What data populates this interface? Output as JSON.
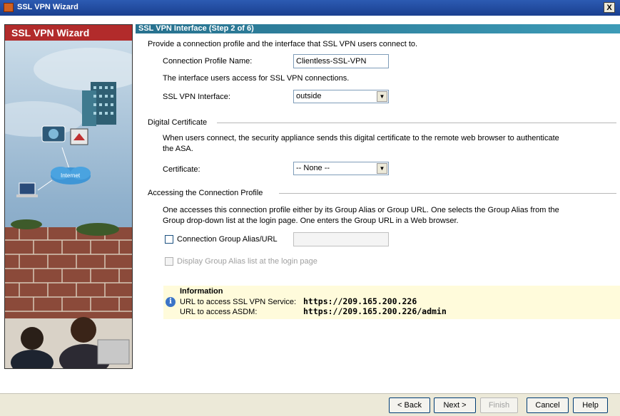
{
  "window": {
    "title": "SSL VPN Wizard",
    "close_label": "X"
  },
  "sidebar": {
    "title": "SSL VPN Wizard",
    "cloud_label": "Internet"
  },
  "header": {
    "step_title": "SSL VPN Interface  (Step 2 of 6)"
  },
  "intro": "Provide a connection profile and the interface that SSL VPN users connect to.",
  "connection_profile": {
    "label": "Connection Profile Name:",
    "value": "Clientless-SSL-VPN"
  },
  "interface_note": "The interface users access for SSL VPN connections.",
  "vpn_interface": {
    "label": "SSL VPN Interface:",
    "value": "outside",
    "arrow": "▼"
  },
  "digital_certificate": {
    "group_title": "Digital Certificate",
    "desc_line1": "When users connect, the security appliance sends this digital certificate to the remote web browser to authenticate",
    "desc_line2": "the ASA.",
    "label": "Certificate:",
    "value": "-- None --",
    "arrow": "▼"
  },
  "accessing": {
    "group_title": "Accessing the Connection Profile",
    "desc_line1": "One accesses this connection profile either by its Group Alias or Group URL. One selects the Group Alias from the",
    "desc_line2": "Group drop-down list at the login page. One enters the Group URL in a Web browser.",
    "alias_checkbox_label": "Connection Group Alias/URL",
    "alias_value": "",
    "display_list_label": "Display Group Alias list at the login page"
  },
  "information": {
    "title": "Information",
    "ssl_label": "URL to access SSL VPN Service:",
    "ssl_url": "https://209.165.200.226",
    "asdm_label": "URL to access ASDM:",
    "asdm_url": "https://209.165.200.226/admin",
    "icon_glyph": "i"
  },
  "buttons": {
    "back": "< Back",
    "next": "Next >",
    "finish": "Finish",
    "cancel": "Cancel",
    "help": "Help"
  }
}
